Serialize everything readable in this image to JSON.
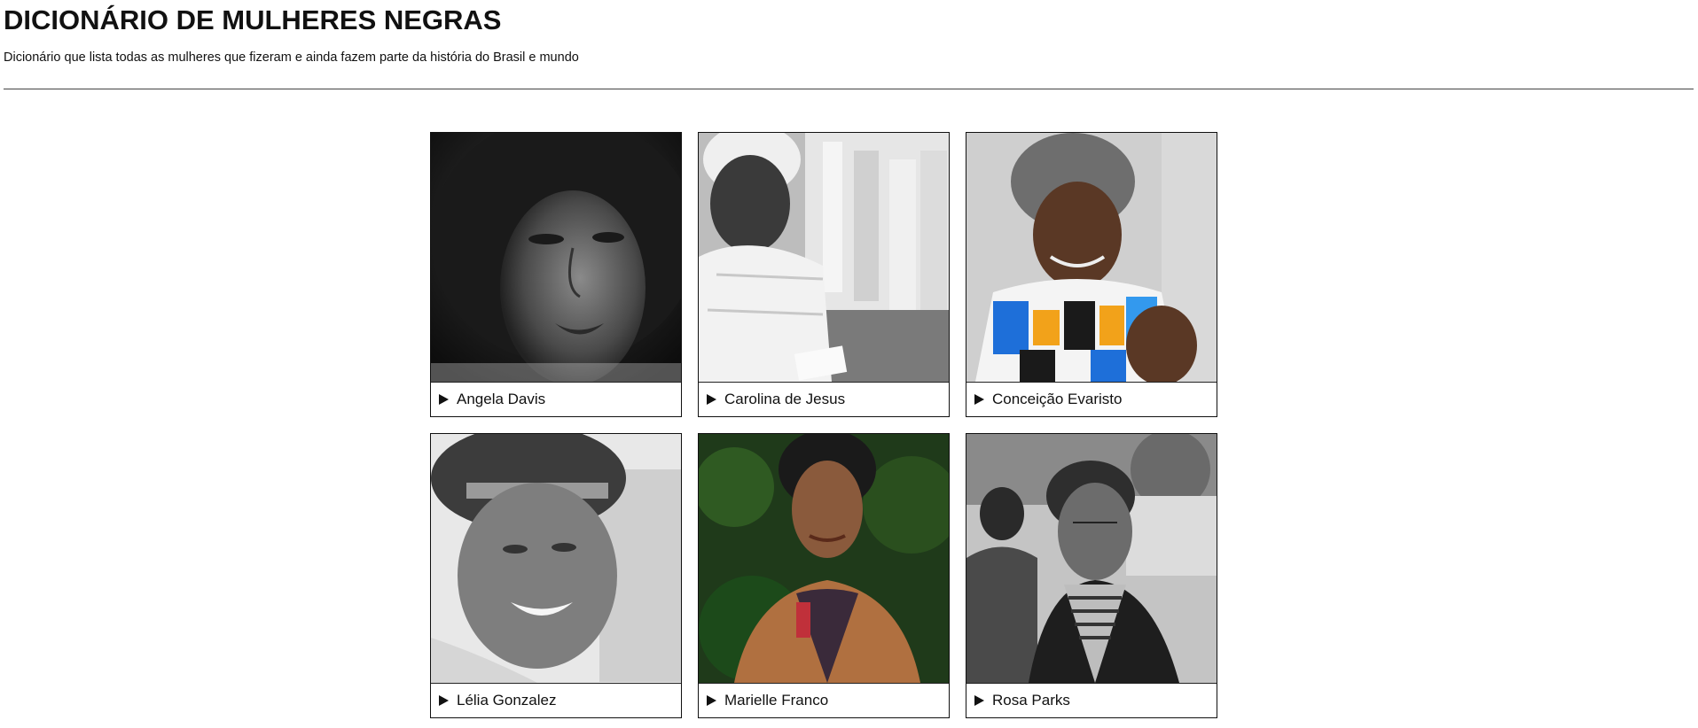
{
  "header": {
    "title": "DICIONÁRIO DE MULHERES NEGRAS",
    "subtitle": "Dicionário que lista todas as mulheres que fizeram e ainda fazem parte da história do Brasil e mundo"
  },
  "cards": [
    {
      "name": "Angela Davis",
      "photo": "portrait-bw",
      "icon": "disclosure-triangle-icon"
    },
    {
      "name": "Carolina de Jesus",
      "photo": "portrait-bw",
      "icon": "disclosure-triangle-icon"
    },
    {
      "name": "Conceição Evaristo",
      "photo": "portrait-color",
      "icon": "disclosure-triangle-icon"
    },
    {
      "name": "Lélia Gonzalez",
      "photo": "portrait-bw",
      "icon": "disclosure-triangle-icon"
    },
    {
      "name": "Marielle Franco",
      "photo": "portrait-color",
      "icon": "disclosure-triangle-icon"
    },
    {
      "name": "Rosa Parks",
      "photo": "portrait-bw",
      "icon": "disclosure-triangle-icon"
    }
  ],
  "colors": {
    "text": "#111111",
    "border": "#111111",
    "background": "#ffffff"
  }
}
